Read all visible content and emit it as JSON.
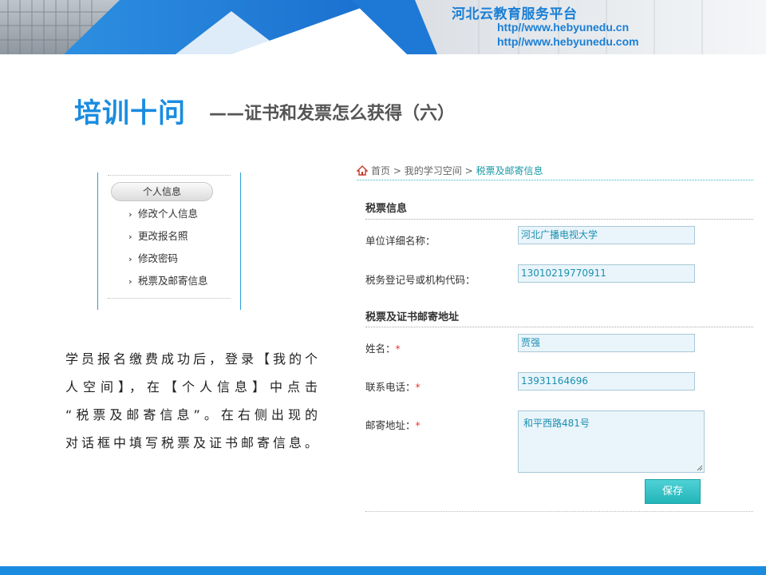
{
  "banner": {
    "title": "河北云教育服务平台",
    "url1": "http//www.hebyunedu.cn",
    "url2": "http//www.hebyunedu.com",
    "accent_color": "#1a7fd6"
  },
  "slide": {
    "title": "培训十问",
    "subtitle": "——证书和发票怎么获得（六）"
  },
  "menu": {
    "header": "个人信息",
    "items": [
      {
        "label": "修改个人信息"
      },
      {
        "label": "更改报名照"
      },
      {
        "label": "修改密码"
      },
      {
        "label": "税票及邮寄信息"
      }
    ]
  },
  "description": {
    "lines": [
      "学员报名缴费成功后，登录【我的个",
      "人空间】，在【个人信息】中点击",
      "“税票及邮寄信息”。在右侧出现的",
      "对话框中填写税票及证书邮寄信息。"
    ]
  },
  "breadcrumb": {
    "home": "首页",
    "sep": ">",
    "space": "我的学习空间",
    "current": "税票及邮寄信息"
  },
  "form": {
    "section1_title": "税票信息",
    "unit_label": "单位详细名称：",
    "unit_value": "河北广播电视大学",
    "tax_label": "税务登记号或机构代码：",
    "tax_value": "13010219770911",
    "section2_title": "税票及证书邮寄地址",
    "name_label": "姓名：",
    "name_value": "贾强",
    "phone_label": "联系电话：",
    "phone_value": "13931164696",
    "address_label": "邮寄地址：",
    "address_value": "和平西路481号",
    "required_mark": "*",
    "save_label": "保存",
    "accent_color": "#22b5b9"
  }
}
